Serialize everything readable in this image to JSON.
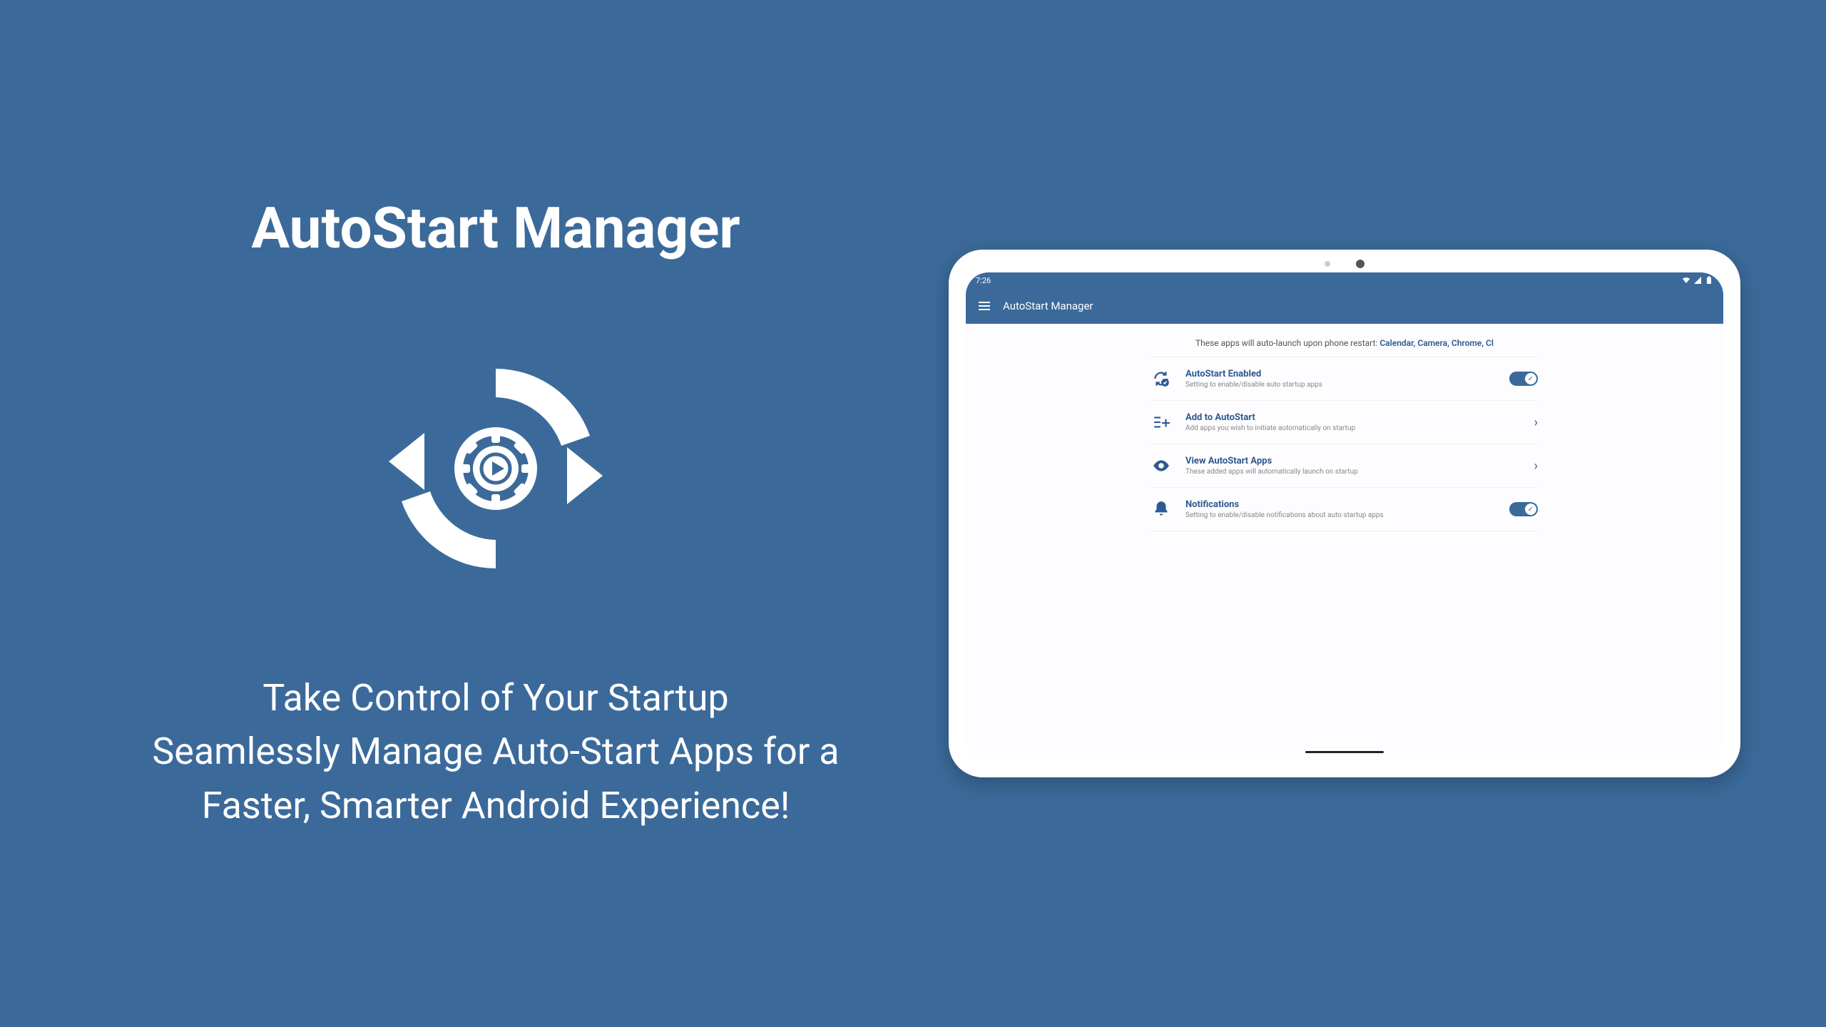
{
  "hero": {
    "title": "AutoStart Manager",
    "tagline_l1": "Take Control of Your Startup",
    "tagline_l2": "Seamlessly Manage Auto-Start Apps for a",
    "tagline_l3": "Faster, Smarter Android Experience!"
  },
  "tablet": {
    "status_time": "7:26",
    "app_bar_title": "AutoStart Manager",
    "info_prefix": "These apps will auto-launch upon phone restart: ",
    "info_apps": "Calendar, Camera, Chrome, Cl",
    "settings": [
      {
        "title": "AutoStart Enabled",
        "sub": "Setting to enable/disable auto startup apps",
        "control": "toggle"
      },
      {
        "title": "Add to AutoStart",
        "sub": "Add apps you wish to initiate automatically on startup",
        "control": "chevron"
      },
      {
        "title": "View AutoStart Apps",
        "sub": "These added apps will automatically launch on startup",
        "control": "chevron"
      },
      {
        "title": "Notifications",
        "sub": "Setting to enable/disable notifications about auto startup apps",
        "control": "toggle"
      }
    ]
  }
}
